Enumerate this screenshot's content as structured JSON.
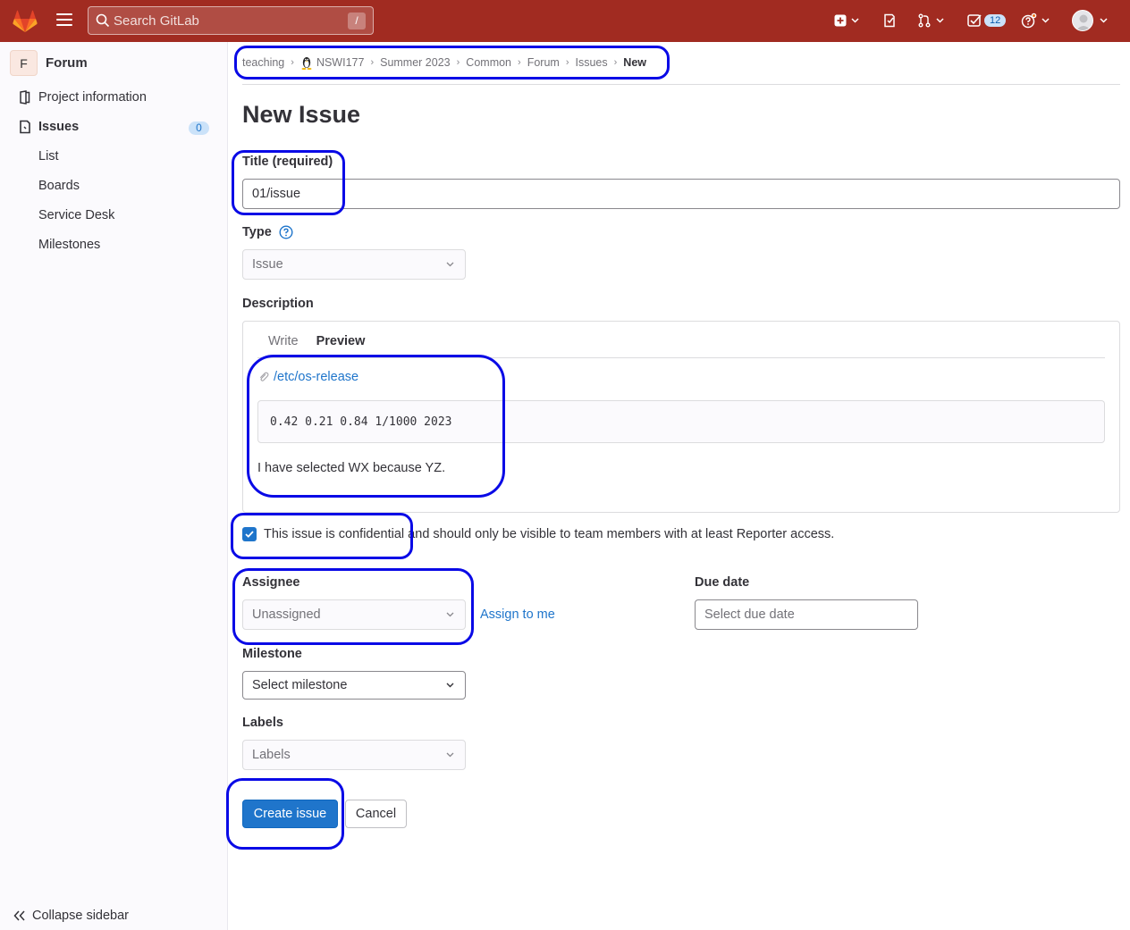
{
  "topbar": {
    "search_placeholder": "Search GitLab",
    "search_shortcut": "/",
    "todo_count": "12"
  },
  "sidebar": {
    "project_initial": "F",
    "project_name": "Forum",
    "items": [
      {
        "label": "Project information"
      },
      {
        "label": "Issues",
        "count": "0"
      }
    ],
    "sub_items": [
      "List",
      "Boards",
      "Service Desk",
      "Milestones"
    ],
    "collapse_label": "Collapse sidebar"
  },
  "breadcrumb": [
    "teaching",
    "NSWI177",
    "Summer 2023",
    "Common",
    "Forum",
    "Issues",
    "New"
  ],
  "page_title": "New Issue",
  "form": {
    "title_label": "Title (required)",
    "title_value": "01/issue",
    "type_label": "Type",
    "type_value": "Issue",
    "description_label": "Description",
    "tabs": [
      "Write",
      "Preview"
    ],
    "attachment_link": "/etc/os-release",
    "code_block": "0.42 0.21 0.84 1/1000 2023",
    "paragraph": "I have selected WX because YZ.",
    "confidential_label": "This issue is confidential and should only be visible to team members with at least Reporter access.",
    "confidential_checked": true,
    "assignee_label": "Assignee",
    "assignee_value": "Unassigned",
    "assign_to_me": "Assign to me",
    "due_date_label": "Due date",
    "due_date_placeholder": "Select due date",
    "milestone_label": "Milestone",
    "milestone_value": "Select milestone",
    "labels_label": "Labels",
    "labels_value": "Labels",
    "create_button": "Create issue",
    "cancel_button": "Cancel"
  },
  "colors": {
    "topbar": "#a12b21",
    "primary": "#1f75cb",
    "annotation": "#0a0ae6"
  }
}
